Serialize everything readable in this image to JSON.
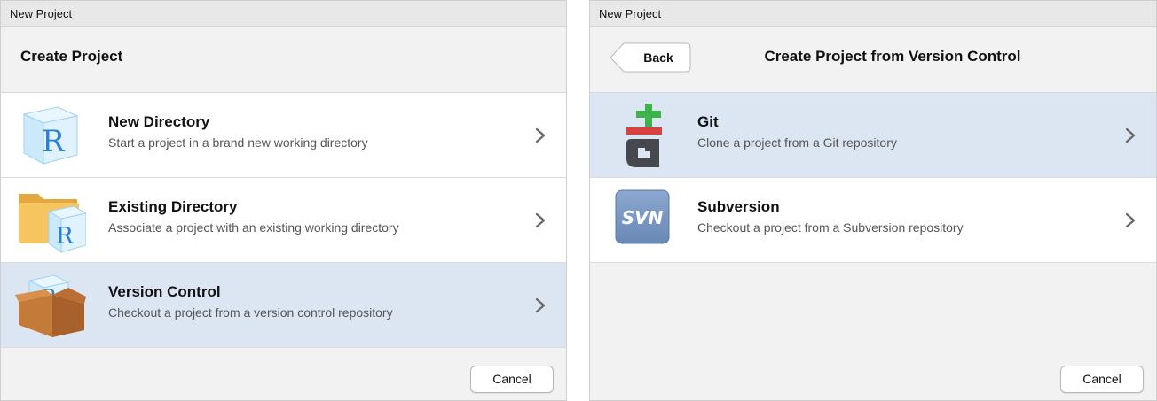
{
  "left_dialog": {
    "window_title": "New Project",
    "heading": "Create Project",
    "items": [
      {
        "title": "New Directory",
        "description": "Start a project in a brand new working directory",
        "icon": "r-cube-icon",
        "selected": false
      },
      {
        "title": "Existing Directory",
        "description": "Associate a project with an existing working directory",
        "icon": "folder-r-icon",
        "selected": false
      },
      {
        "title": "Version Control",
        "description": "Checkout a project from a version control repository",
        "icon": "box-r-icon",
        "selected": true
      }
    ],
    "cancel_label": "Cancel"
  },
  "right_dialog": {
    "window_title": "New Project",
    "back_label": "Back",
    "heading": "Create Project from Version Control",
    "items": [
      {
        "title": "Git",
        "description": "Clone a project from a Git repository",
        "icon": "git-icon",
        "selected": true
      },
      {
        "title": "Subversion",
        "description": "Checkout a project from a Subversion repository",
        "icon": "svn-icon",
        "icon_text": "SVN",
        "selected": false
      }
    ],
    "cancel_label": "Cancel"
  },
  "colors": {
    "selected_row": "#dce6f3",
    "git_green": "#3db34a",
    "git_red": "#d94040",
    "git_dark": "#45494d",
    "svn_blue": "#7a98c2",
    "r_blue": "#2a7fd4"
  }
}
